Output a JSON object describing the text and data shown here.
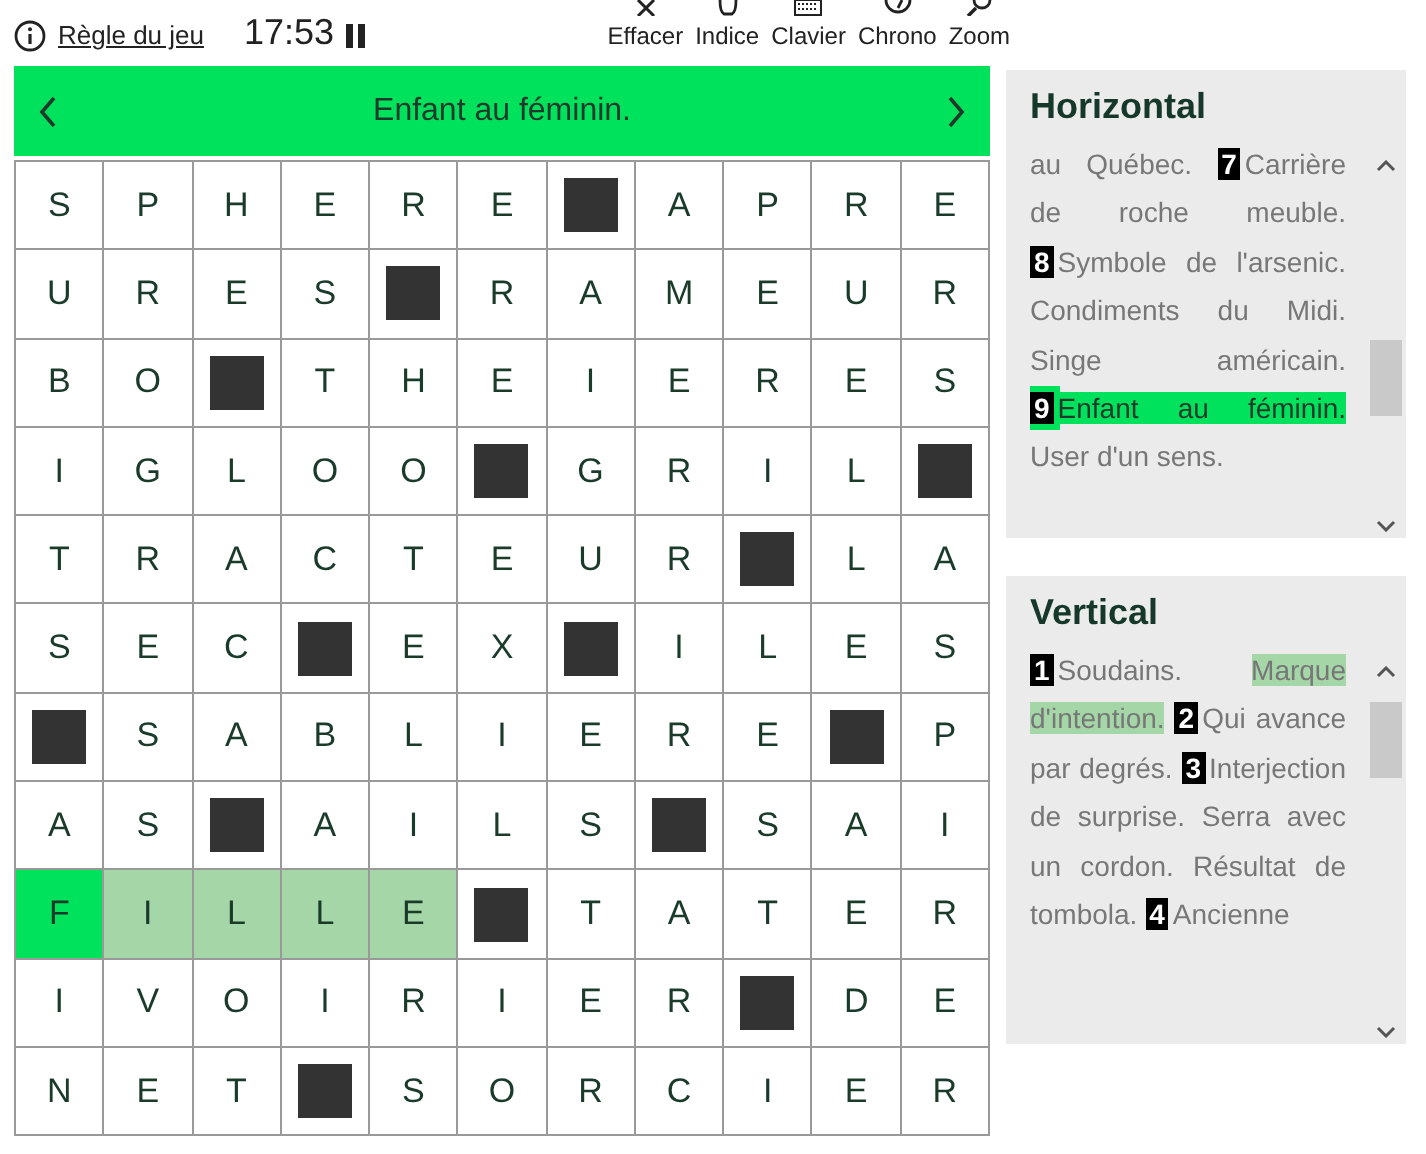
{
  "header": {
    "rules_link": "Règle du jeu",
    "timer": "17:53",
    "paused": false,
    "tools": [
      {
        "kind": "erase",
        "label": "Effacer"
      },
      {
        "kind": "hint",
        "label": "Indice"
      },
      {
        "kind": "keyboard",
        "label": "Clavier"
      },
      {
        "kind": "chrono",
        "label": "Chrono"
      },
      {
        "kind": "zoom",
        "label": "Zoom"
      }
    ]
  },
  "clue_bar": {
    "text": "Enfant au féminin."
  },
  "grid": [
    [
      {
        "kind": "letter",
        "letter": "S",
        "selected": false,
        "in_word": false
      },
      {
        "kind": "letter",
        "letter": "P",
        "selected": false,
        "in_word": false
      },
      {
        "kind": "letter",
        "letter": "H",
        "selected": false,
        "in_word": false
      },
      {
        "kind": "letter",
        "letter": "E",
        "selected": false,
        "in_word": false
      },
      {
        "kind": "letter",
        "letter": "R",
        "selected": false,
        "in_word": false
      },
      {
        "kind": "letter",
        "letter": "E",
        "selected": false,
        "in_word": false
      },
      {
        "kind": "block"
      },
      {
        "kind": "letter",
        "letter": "A",
        "selected": false,
        "in_word": false
      },
      {
        "kind": "letter",
        "letter": "P",
        "selected": false,
        "in_word": false
      },
      {
        "kind": "letter",
        "letter": "R",
        "selected": false,
        "in_word": false
      },
      {
        "kind": "letter",
        "letter": "E",
        "selected": false,
        "in_word": false
      }
    ],
    [
      {
        "kind": "letter",
        "letter": "U",
        "selected": false,
        "in_word": false
      },
      {
        "kind": "letter",
        "letter": "R",
        "selected": false,
        "in_word": false
      },
      {
        "kind": "letter",
        "letter": "E",
        "selected": false,
        "in_word": false
      },
      {
        "kind": "letter",
        "letter": "S",
        "selected": false,
        "in_word": false
      },
      {
        "kind": "block"
      },
      {
        "kind": "letter",
        "letter": "R",
        "selected": false,
        "in_word": false
      },
      {
        "kind": "letter",
        "letter": "A",
        "selected": false,
        "in_word": false
      },
      {
        "kind": "letter",
        "letter": "M",
        "selected": false,
        "in_word": false
      },
      {
        "kind": "letter",
        "letter": "E",
        "selected": false,
        "in_word": false
      },
      {
        "kind": "letter",
        "letter": "U",
        "selected": false,
        "in_word": false
      },
      {
        "kind": "letter",
        "letter": "R",
        "selected": false,
        "in_word": false
      }
    ],
    [
      {
        "kind": "letter",
        "letter": "B",
        "selected": false,
        "in_word": false
      },
      {
        "kind": "letter",
        "letter": "O",
        "selected": false,
        "in_word": false
      },
      {
        "kind": "block"
      },
      {
        "kind": "letter",
        "letter": "T",
        "selected": false,
        "in_word": false
      },
      {
        "kind": "letter",
        "letter": "H",
        "selected": false,
        "in_word": false
      },
      {
        "kind": "letter",
        "letter": "E",
        "selected": false,
        "in_word": false
      },
      {
        "kind": "letter",
        "letter": "I",
        "selected": false,
        "in_word": false
      },
      {
        "kind": "letter",
        "letter": "E",
        "selected": false,
        "in_word": false
      },
      {
        "kind": "letter",
        "letter": "R",
        "selected": false,
        "in_word": false
      },
      {
        "kind": "letter",
        "letter": "E",
        "selected": false,
        "in_word": false
      },
      {
        "kind": "letter",
        "letter": "S",
        "selected": false,
        "in_word": false
      }
    ],
    [
      {
        "kind": "letter",
        "letter": "I",
        "selected": false,
        "in_word": false
      },
      {
        "kind": "letter",
        "letter": "G",
        "selected": false,
        "in_word": false
      },
      {
        "kind": "letter",
        "letter": "L",
        "selected": false,
        "in_word": false
      },
      {
        "kind": "letter",
        "letter": "O",
        "selected": false,
        "in_word": false
      },
      {
        "kind": "letter",
        "letter": "O",
        "selected": false,
        "in_word": false
      },
      {
        "kind": "block"
      },
      {
        "kind": "letter",
        "letter": "G",
        "selected": false,
        "in_word": false
      },
      {
        "kind": "letter",
        "letter": "R",
        "selected": false,
        "in_word": false
      },
      {
        "kind": "letter",
        "letter": "I",
        "selected": false,
        "in_word": false
      },
      {
        "kind": "letter",
        "letter": "L",
        "selected": false,
        "in_word": false
      },
      {
        "kind": "block"
      }
    ],
    [
      {
        "kind": "letter",
        "letter": "T",
        "selected": false,
        "in_word": false
      },
      {
        "kind": "letter",
        "letter": "R",
        "selected": false,
        "in_word": false
      },
      {
        "kind": "letter",
        "letter": "A",
        "selected": false,
        "in_word": false
      },
      {
        "kind": "letter",
        "letter": "C",
        "selected": false,
        "in_word": false
      },
      {
        "kind": "letter",
        "letter": "T",
        "selected": false,
        "in_word": false
      },
      {
        "kind": "letter",
        "letter": "E",
        "selected": false,
        "in_word": false
      },
      {
        "kind": "letter",
        "letter": "U",
        "selected": false,
        "in_word": false
      },
      {
        "kind": "letter",
        "letter": "R",
        "selected": false,
        "in_word": false
      },
      {
        "kind": "block"
      },
      {
        "kind": "letter",
        "letter": "L",
        "selected": false,
        "in_word": false
      },
      {
        "kind": "letter",
        "letter": "A",
        "selected": false,
        "in_word": false
      }
    ],
    [
      {
        "kind": "letter",
        "letter": "S",
        "selected": false,
        "in_word": false
      },
      {
        "kind": "letter",
        "letter": "E",
        "selected": false,
        "in_word": false
      },
      {
        "kind": "letter",
        "letter": "C",
        "selected": false,
        "in_word": false
      },
      {
        "kind": "block"
      },
      {
        "kind": "letter",
        "letter": "E",
        "selected": false,
        "in_word": false
      },
      {
        "kind": "letter",
        "letter": "X",
        "selected": false,
        "in_word": false
      },
      {
        "kind": "block"
      },
      {
        "kind": "letter",
        "letter": "I",
        "selected": false,
        "in_word": false
      },
      {
        "kind": "letter",
        "letter": "L",
        "selected": false,
        "in_word": false
      },
      {
        "kind": "letter",
        "letter": "E",
        "selected": false,
        "in_word": false
      },
      {
        "kind": "letter",
        "letter": "S",
        "selected": false,
        "in_word": false
      }
    ],
    [
      {
        "kind": "block"
      },
      {
        "kind": "letter",
        "letter": "S",
        "selected": false,
        "in_word": false
      },
      {
        "kind": "letter",
        "letter": "A",
        "selected": false,
        "in_word": false
      },
      {
        "kind": "letter",
        "letter": "B",
        "selected": false,
        "in_word": false
      },
      {
        "kind": "letter",
        "letter": "L",
        "selected": false,
        "in_word": false
      },
      {
        "kind": "letter",
        "letter": "I",
        "selected": false,
        "in_word": false
      },
      {
        "kind": "letter",
        "letter": "E",
        "selected": false,
        "in_word": false
      },
      {
        "kind": "letter",
        "letter": "R",
        "selected": false,
        "in_word": false
      },
      {
        "kind": "letter",
        "letter": "E",
        "selected": false,
        "in_word": false
      },
      {
        "kind": "block"
      },
      {
        "kind": "letter",
        "letter": "P",
        "selected": false,
        "in_word": false
      }
    ],
    [
      {
        "kind": "letter",
        "letter": "A",
        "selected": false,
        "in_word": false
      },
      {
        "kind": "letter",
        "letter": "S",
        "selected": false,
        "in_word": false
      },
      {
        "kind": "block"
      },
      {
        "kind": "letter",
        "letter": "A",
        "selected": false,
        "in_word": false
      },
      {
        "kind": "letter",
        "letter": "I",
        "selected": false,
        "in_word": false
      },
      {
        "kind": "letter",
        "letter": "L",
        "selected": false,
        "in_word": false
      },
      {
        "kind": "letter",
        "letter": "S",
        "selected": false,
        "in_word": false
      },
      {
        "kind": "block"
      },
      {
        "kind": "letter",
        "letter": "S",
        "selected": false,
        "in_word": false
      },
      {
        "kind": "letter",
        "letter": "A",
        "selected": false,
        "in_word": false
      },
      {
        "kind": "letter",
        "letter": "I",
        "selected": false,
        "in_word": false
      }
    ],
    [
      {
        "kind": "letter",
        "letter": "F",
        "selected": true,
        "in_word": true
      },
      {
        "kind": "letter",
        "letter": "I",
        "selected": false,
        "in_word": true
      },
      {
        "kind": "letter",
        "letter": "L",
        "selected": false,
        "in_word": true
      },
      {
        "kind": "letter",
        "letter": "L",
        "selected": false,
        "in_word": true
      },
      {
        "kind": "letter",
        "letter": "E",
        "selected": false,
        "in_word": true
      },
      {
        "kind": "block"
      },
      {
        "kind": "letter",
        "letter": "T",
        "selected": false,
        "in_word": false
      },
      {
        "kind": "letter",
        "letter": "A",
        "selected": false,
        "in_word": false
      },
      {
        "kind": "letter",
        "letter": "T",
        "selected": false,
        "in_word": false
      },
      {
        "kind": "letter",
        "letter": "E",
        "selected": false,
        "in_word": false
      },
      {
        "kind": "letter",
        "letter": "R",
        "selected": false,
        "in_word": false
      }
    ],
    [
      {
        "kind": "letter",
        "letter": "I",
        "selected": false,
        "in_word": false
      },
      {
        "kind": "letter",
        "letter": "V",
        "selected": false,
        "in_word": false
      },
      {
        "kind": "letter",
        "letter": "O",
        "selected": false,
        "in_word": false
      },
      {
        "kind": "letter",
        "letter": "I",
        "selected": false,
        "in_word": false
      },
      {
        "kind": "letter",
        "letter": "R",
        "selected": false,
        "in_word": false
      },
      {
        "kind": "letter",
        "letter": "I",
        "selected": false,
        "in_word": false
      },
      {
        "kind": "letter",
        "letter": "E",
        "selected": false,
        "in_word": false
      },
      {
        "kind": "letter",
        "letter": "R",
        "selected": false,
        "in_word": false
      },
      {
        "kind": "block"
      },
      {
        "kind": "letter",
        "letter": "D",
        "selected": false,
        "in_word": false
      },
      {
        "kind": "letter",
        "letter": "E",
        "selected": false,
        "in_word": false
      }
    ],
    [
      {
        "kind": "letter",
        "letter": "N",
        "selected": false,
        "in_word": false
      },
      {
        "kind": "letter",
        "letter": "E",
        "selected": false,
        "in_word": false
      },
      {
        "kind": "letter",
        "letter": "T",
        "selected": false,
        "in_word": false
      },
      {
        "kind": "block"
      },
      {
        "kind": "letter",
        "letter": "S",
        "selected": false,
        "in_word": false
      },
      {
        "kind": "letter",
        "letter": "O",
        "selected": false,
        "in_word": false
      },
      {
        "kind": "letter",
        "letter": "R",
        "selected": false,
        "in_word": false
      },
      {
        "kind": "letter",
        "letter": "C",
        "selected": false,
        "in_word": false
      },
      {
        "kind": "letter",
        "letter": "I",
        "selected": false,
        "in_word": false
      },
      {
        "kind": "letter",
        "letter": "E",
        "selected": false,
        "in_word": false
      },
      {
        "kind": "letter",
        "letter": "R",
        "selected": false,
        "in_word": false
      }
    ]
  ],
  "panels": [
    {
      "title": "Horizontal",
      "segments": [
        {
          "kind": "text",
          "text": "au Québec.",
          "selected": false,
          "related": false
        },
        {
          "kind": "number",
          "text": "7",
          "selected": false,
          "related": false
        },
        {
          "kind": "text",
          "text": "Carrière de roche meuble.",
          "selected": false,
          "related": false
        },
        {
          "kind": "number",
          "text": "8",
          "selected": false,
          "related": false
        },
        {
          "kind": "text",
          "text": "Symbole de l'arsenic. Condiments du Midi. Singe américain.",
          "selected": false,
          "related": false
        },
        {
          "kind": "number",
          "text": "9",
          "selected": true,
          "related": false
        },
        {
          "kind": "text",
          "text": "Enfant au féminin.",
          "selected": true,
          "related": false
        },
        {
          "kind": "text",
          "text": "User d'un sens.",
          "selected": false,
          "related": false
        }
      ]
    },
    {
      "title": "Vertical",
      "segments": [
        {
          "kind": "number",
          "text": "1",
          "selected": false,
          "related": false
        },
        {
          "kind": "text",
          "text": "Soudains.",
          "selected": false,
          "related": false
        },
        {
          "kind": "text",
          "text": "Marque d'intention.",
          "selected": false,
          "related": true
        },
        {
          "kind": "number",
          "text": "2",
          "selected": false,
          "related": false
        },
        {
          "kind": "text",
          "text": "Qui avance par degrés.",
          "selected": false,
          "related": false
        },
        {
          "kind": "number",
          "text": "3",
          "selected": false,
          "related": false
        },
        {
          "kind": "text",
          "text": "Interjection de surprise. Serra avec un cordon. Résultat de tombola.",
          "selected": false,
          "related": false
        },
        {
          "kind": "number",
          "text": "4",
          "selected": false,
          "related": false
        },
        {
          "kind": "text",
          "text": "Ancienne",
          "selected": false,
          "related": false
        }
      ]
    }
  ]
}
